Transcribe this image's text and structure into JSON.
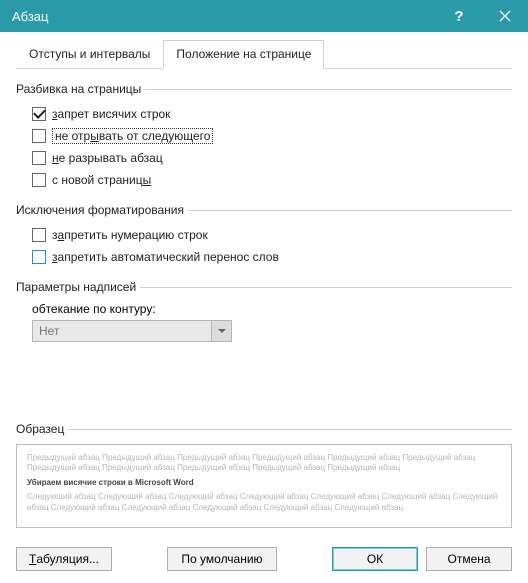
{
  "titlebar": {
    "title": "Абзац"
  },
  "tabs": {
    "indent": "Отступы и и",
    "indent_ul": "н",
    "indent_rest": "тервалы",
    "position": "Поло",
    "position_ul": "ж",
    "position_rest": "ение на странице"
  },
  "groups": {
    "pagination": "Разбивка на страницы",
    "exceptions": "Исключения форматирования",
    "caption": "Параметры надписей",
    "preview": "Образец"
  },
  "checkboxes": {
    "widow_ul": "з",
    "widow_rest": "апрет висячих строк",
    "keep_next_pre": "не отр",
    "keep_next_ul": "ы",
    "keep_next_rest": "вать от следующего",
    "keep_lines_ul": "н",
    "keep_lines_rest": "е разрывать абзац",
    "page_break_pre": "с новой страниц",
    "page_break_ul": "ы",
    "suppress_num_pre": "з",
    "suppress_num_ul": "а",
    "suppress_num_rest": "претить нумерацию строк",
    "suppress_hyph_ul": "з",
    "suppress_hyph_rest": "апретить автоматический перенос слов"
  },
  "caption": {
    "wrap_label_pre": "о",
    "wrap_label_ul": "б",
    "wrap_label_rest": "текание по контуру:",
    "wrap_value": "Нет"
  },
  "preview": {
    "prev_text": "Предыдущий абзац Предыдущий абзац Предыдущий абзац Предыдущий абзац Предыдущий абзац Предыдущий абзац Предыдущий абзац Предыдущий абзац Предыдущий абзац Предыдущий абзац Предыдущий абзац",
    "sample_text": "Убираем висячие строки в Microsoft Word",
    "next_text": "Следующий абзац Следующий абзац Следующий абзац Следующий абзац Следующий абзац Следующий абзац Следующий абзац Следующий абзац Следующий абзац Следующий абзац Следующий абзац Следующий абзац"
  },
  "buttons": {
    "tabs_ul": "Т",
    "tabs_rest": "абуляция...",
    "default": "По умолчанию",
    "ok": "ОК",
    "cancel": "Отмена"
  }
}
